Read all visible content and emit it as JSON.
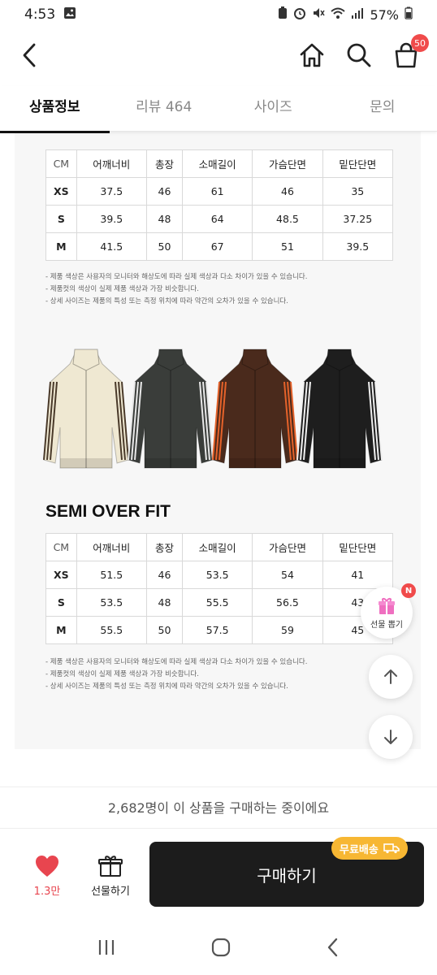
{
  "status_bar": {
    "time": "4:53",
    "battery": "57%"
  },
  "nav": {
    "cart_count": "50"
  },
  "tabs": [
    {
      "label": "상품정보",
      "active": true
    },
    {
      "label": "리뷰 464",
      "active": false
    },
    {
      "label": "사이즈",
      "active": false
    },
    {
      "label": "문의",
      "active": false
    }
  ],
  "size_tables": [
    {
      "headers": [
        "CM",
        "어깨너비",
        "총장",
        "소매길이",
        "가슴단면",
        "밑단단면"
      ],
      "rows": [
        [
          "XS",
          "37.5",
          "46",
          "61",
          "46",
          "35"
        ],
        [
          "S",
          "39.5",
          "48",
          "64",
          "48.5",
          "37.25"
        ],
        [
          "M",
          "41.5",
          "50",
          "67",
          "51",
          "39.5"
        ]
      ]
    },
    {
      "title": "SEMI OVER FIT",
      "headers": [
        "CM",
        "어깨너비",
        "총장",
        "소매길이",
        "가슴단면",
        "밑단단면"
      ],
      "rows": [
        [
          "XS",
          "51.5",
          "46",
          "53.5",
          "54",
          "41"
        ],
        [
          "S",
          "53.5",
          "48",
          "55.5",
          "56.5",
          "43"
        ],
        [
          "M",
          "55.5",
          "50",
          "57.5",
          "59",
          "45"
        ]
      ]
    }
  ],
  "notes": [
    "- 제품 색상은 사용자의 모니터와 해상도에 따라 실제 색상과 다소 차이가 있을 수 있습니다.",
    "- 제품컷의 색상이 실제 제품 색상과 가장 비슷합니다.",
    "- 상세 사이즈는 제품의 특성 또는 측정 위치에 따라 약간의 오차가 있을 수 있습니다."
  ],
  "jackets": [
    {
      "color": "#efe8d2",
      "stripe": "#4a3a2a",
      "name": "cream-jacket"
    },
    {
      "color": "#3a3d3a",
      "stripe": "#e8e8e8",
      "name": "charcoal-jacket"
    },
    {
      "color": "#4a2a1c",
      "stripe": "#e5622a",
      "name": "brown-jacket"
    },
    {
      "color": "#1e1e1e",
      "stripe": "#f0f0f0",
      "name": "black-jacket"
    }
  ],
  "floating": {
    "gift_label": "선물 뽑기",
    "gift_badge": "N"
  },
  "buyers_banner": "2,682명이 이 상품을 구매하는 중이에요",
  "actions": {
    "like_count": "1.3만",
    "gift_label": "선물하기",
    "buy_label": "구매하기",
    "shipping_badge": "무료배송"
  },
  "colors": {
    "accent": "#f04b4b",
    "buy_button": "#1c1c1c",
    "shipping_badge": "#f7b733"
  }
}
